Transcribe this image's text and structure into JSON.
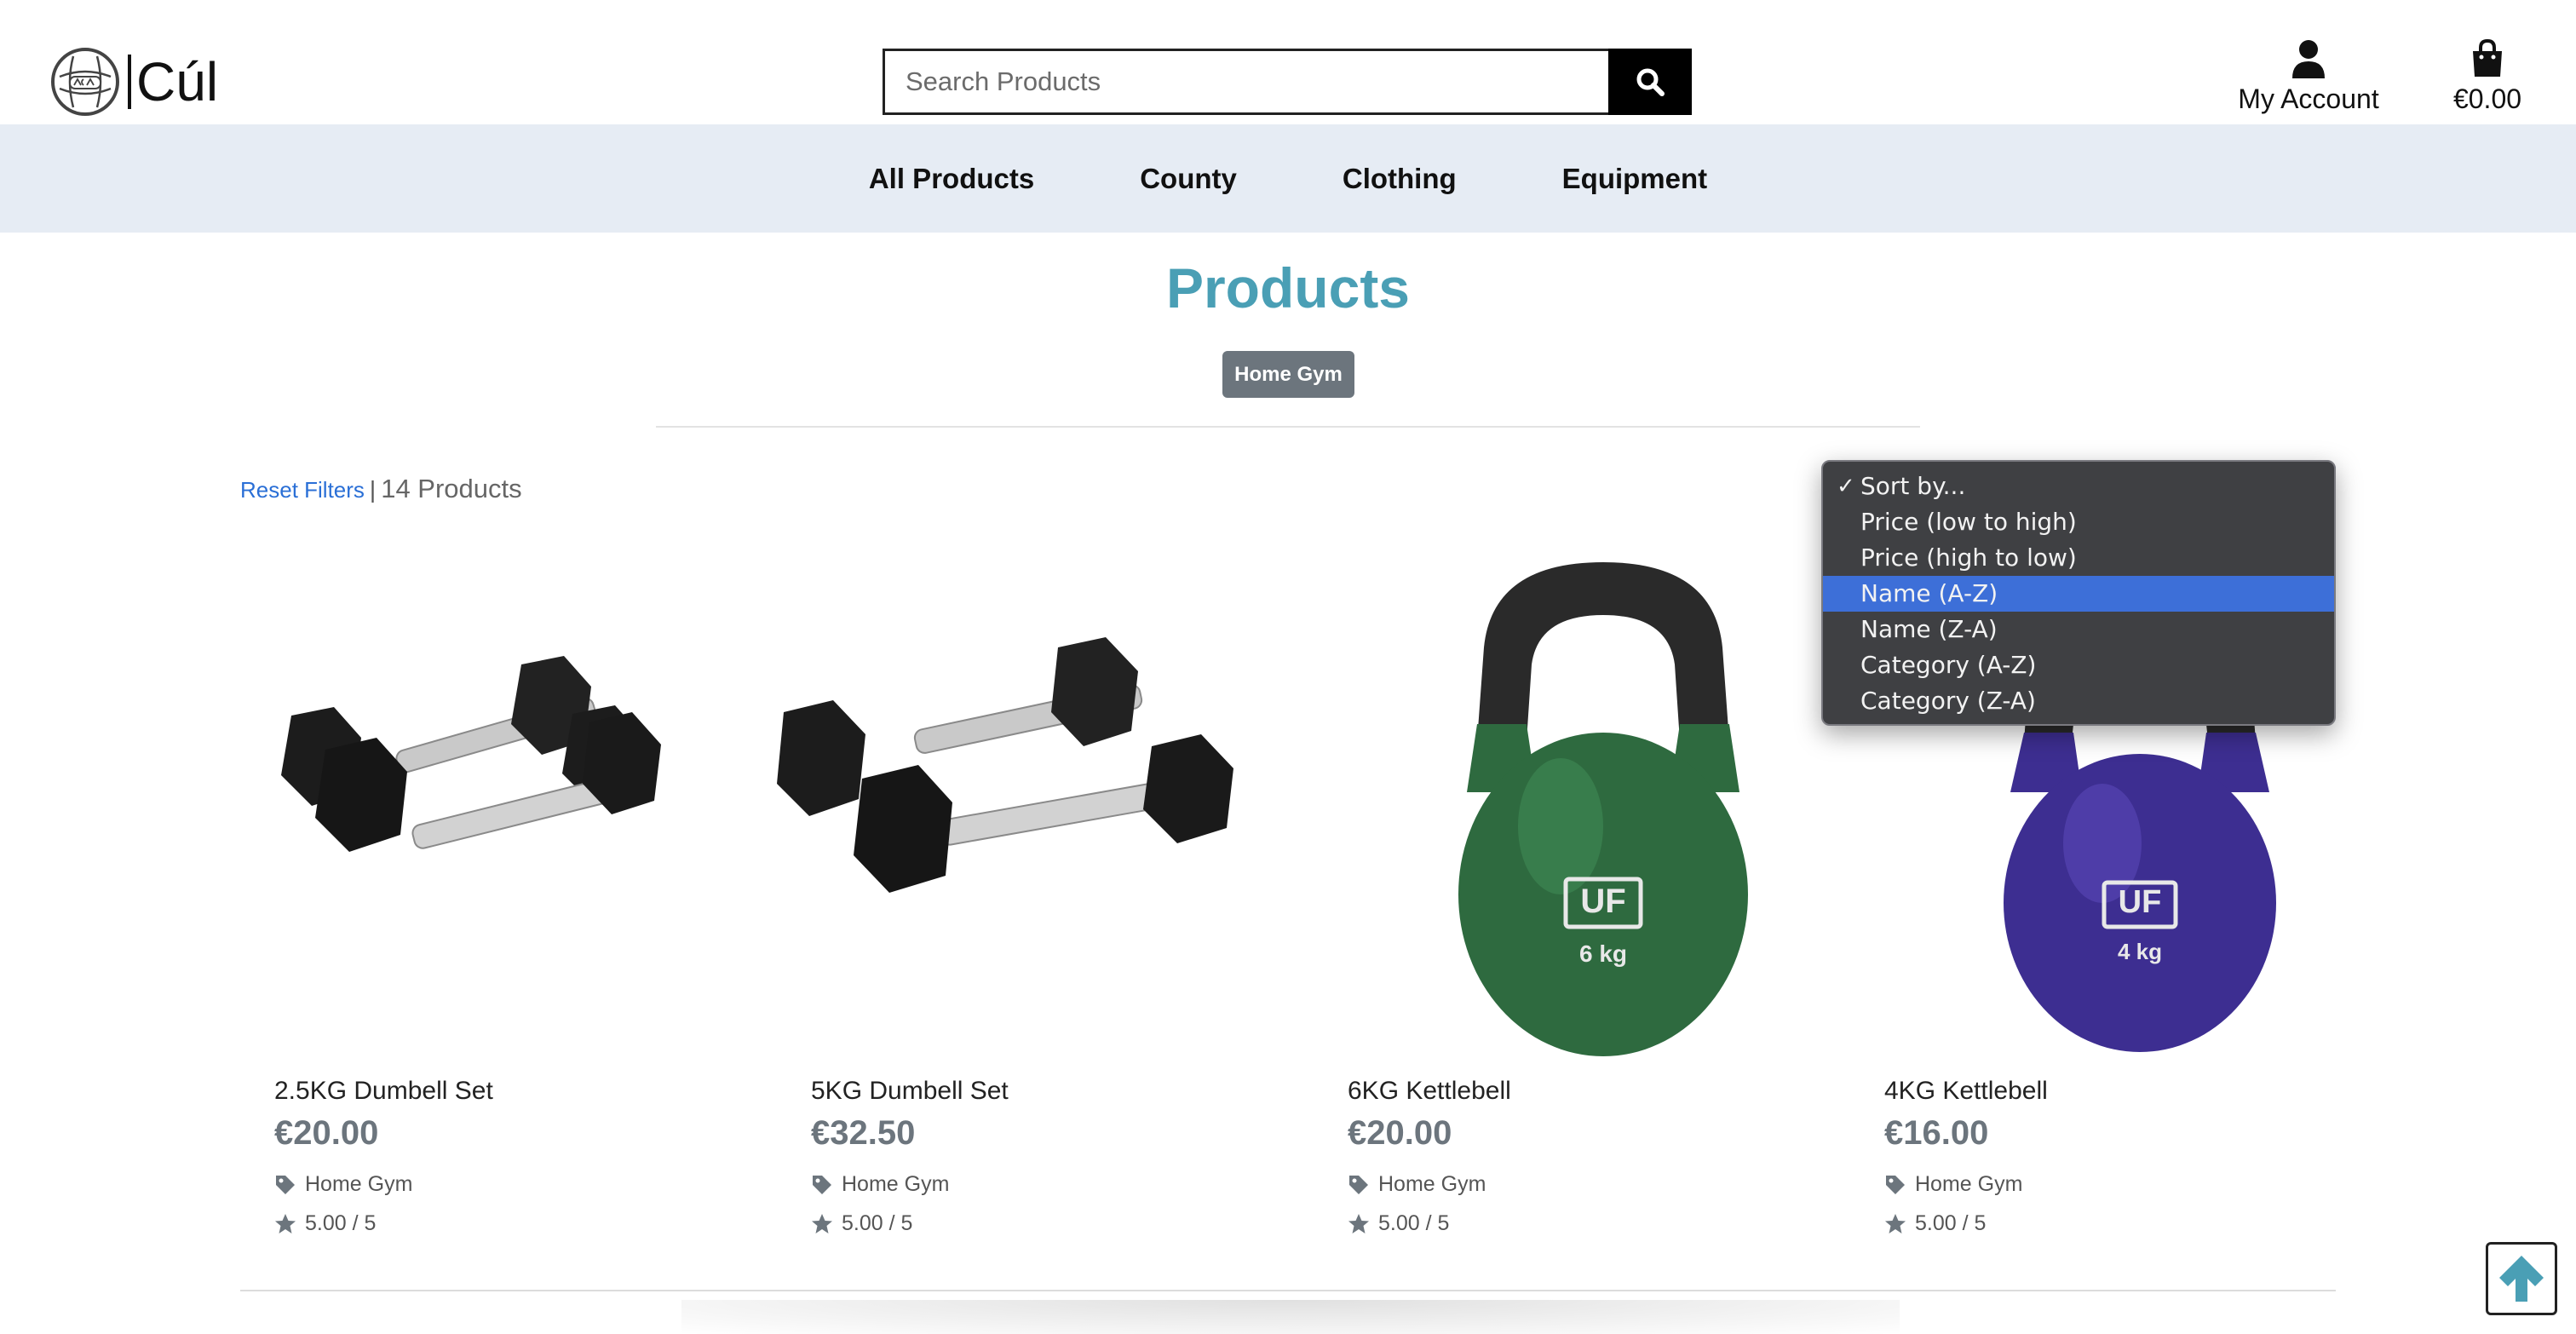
{
  "brand": {
    "name": "Cúl",
    "logo_icon": "gaelic-football-icon"
  },
  "search": {
    "placeholder": "Search Products",
    "value": ""
  },
  "header": {
    "account_label": "My Account",
    "cart_total": "€0.00"
  },
  "nav": {
    "items": [
      "All Products",
      "County",
      "Clothing",
      "Equipment"
    ]
  },
  "page": {
    "title": "Products",
    "category_badge": "Home Gym"
  },
  "filters": {
    "reset_label": "Reset Filters",
    "separator": "|",
    "count": "14 Products"
  },
  "sort": {
    "check_mark": "✓",
    "selected_index": 3,
    "options": [
      "Sort by...",
      "Price (low to high)",
      "Price (high to low)",
      "Name (A-Z)",
      "Name (Z-A)",
      "Category (A-Z)",
      "Category (Z-A)"
    ]
  },
  "products": [
    {
      "name": "2.5KG Dumbell Set",
      "price": "€20.00",
      "category": "Home Gym",
      "rating": "5.00 / 5"
    },
    {
      "name": "5KG Dumbell Set",
      "price": "€32.50",
      "category": "Home Gym",
      "rating": "5.00 / 5"
    },
    {
      "name": "6KG Kettlebell",
      "price": "€20.00",
      "category": "Home Gym",
      "rating": "5.00 / 5",
      "brand_mark": "UF",
      "weight": "6 kg",
      "bell_color": "#2e6a3f"
    },
    {
      "name": "4KG Kettlebell",
      "price": "€16.00",
      "category": "Home Gym",
      "rating": "5.00 / 5",
      "brand_mark": "UF",
      "weight": "4 kg",
      "bell_color": "#3d2e91"
    }
  ],
  "colors": {
    "accent": "#4a9fb5",
    "nav_bg": "#e6ecf4",
    "badge_bg": "#6c757d",
    "link": "#2a6fd6",
    "dropdown_selected": "#3d6fd8"
  }
}
